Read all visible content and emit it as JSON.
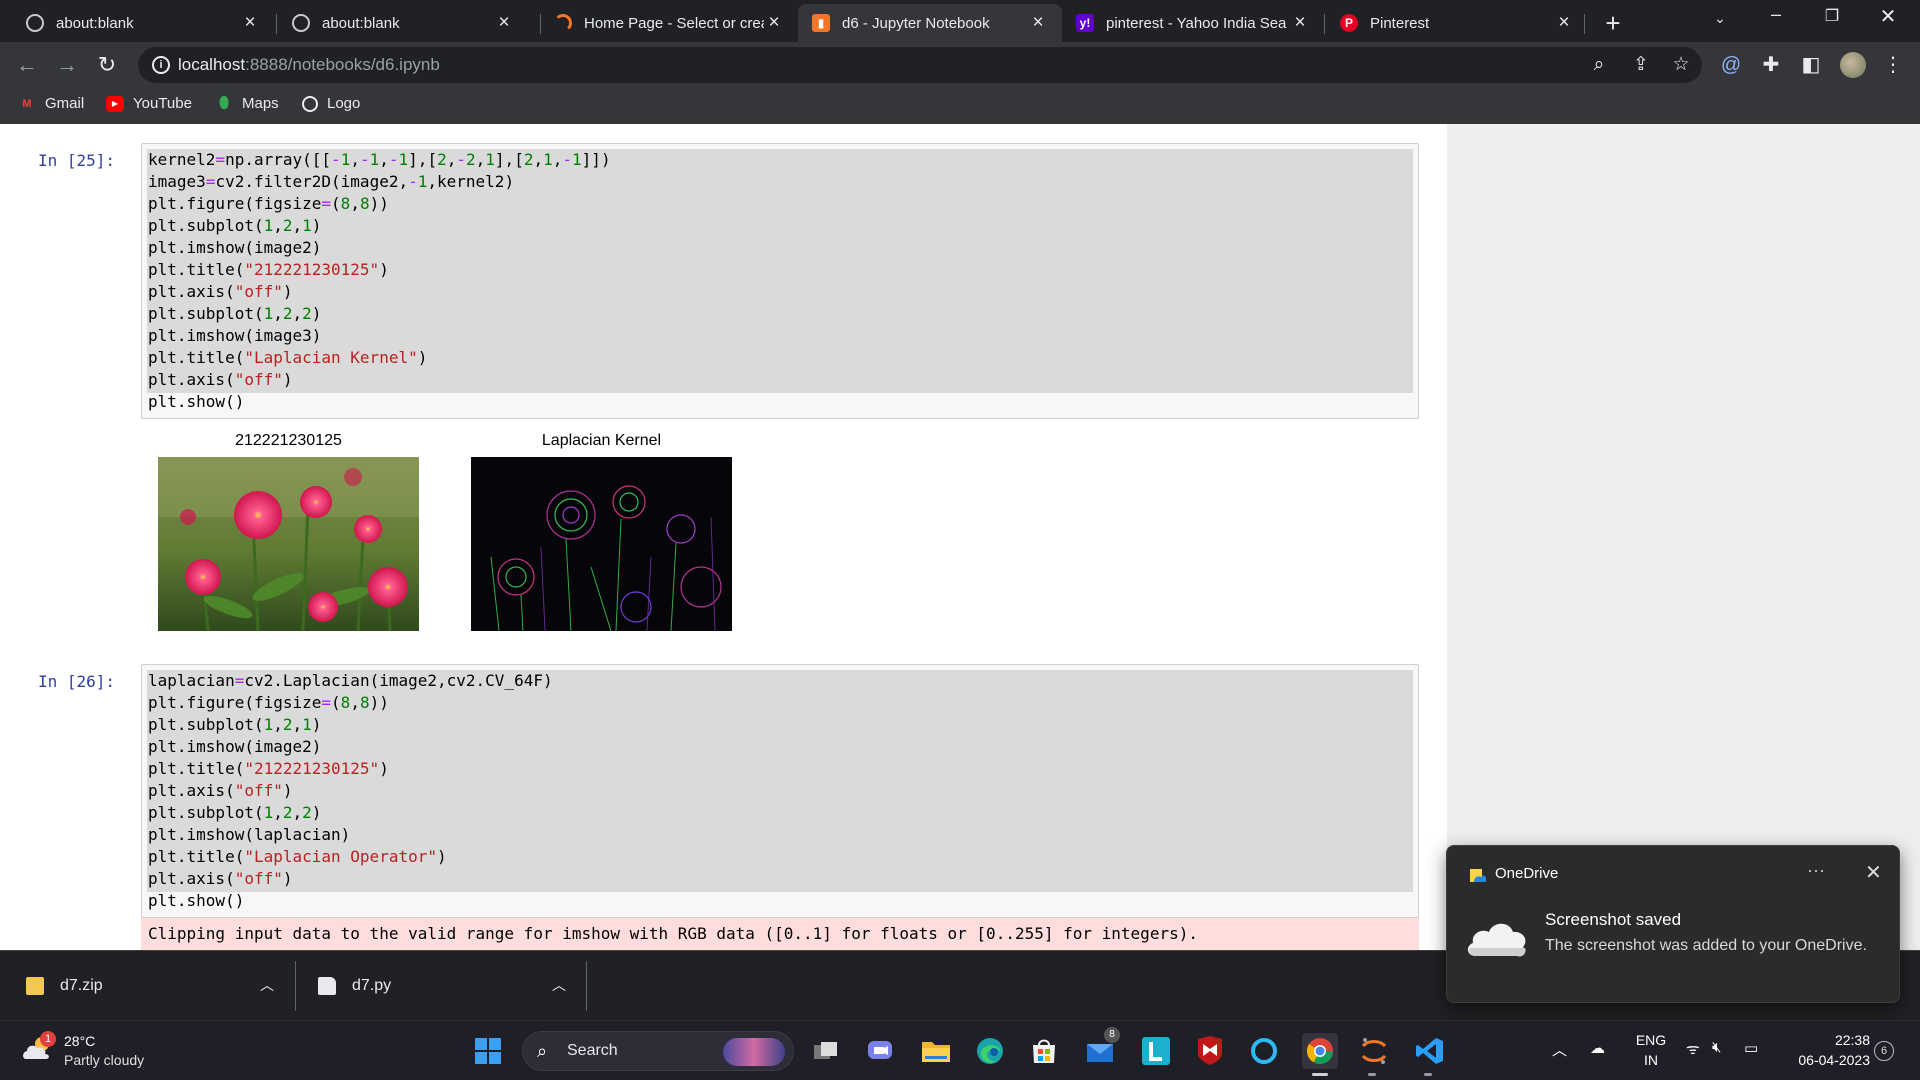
{
  "browser": {
    "tabs": [
      {
        "title": "about:blank",
        "icon": "globe-icon"
      },
      {
        "title": "about:blank",
        "icon": "globe-icon"
      },
      {
        "title": "Home Page - Select or crea",
        "icon": "loading-icon"
      },
      {
        "title": "d6 - Jupyter Notebook",
        "icon": "jupyter-icon"
      },
      {
        "title": "pinterest - Yahoo India Sea",
        "icon": "yahoo-icon"
      },
      {
        "title": "Pinterest",
        "icon": "pinterest-icon"
      }
    ],
    "active_tab": 3,
    "url": {
      "host": "localhost",
      "path": ":8888/notebooks/d6.ipynb"
    },
    "bookmarks": [
      {
        "label": "Gmail",
        "icon": "gmail-icon"
      },
      {
        "label": "YouTube",
        "icon": "youtube-icon"
      },
      {
        "label": "Maps",
        "icon": "maps-icon"
      },
      {
        "label": "Logo",
        "icon": "globe-icon"
      }
    ]
  },
  "notebook": {
    "cell25": {
      "prompt": "In [25]:",
      "code": [
        "kernel2=np.array([[-1,-1,-1],[2,-2,1],[2,1,-1]])",
        "image3=cv2.filter2D(image2,-1,kernel2)",
        "plt.figure(figsize=(8,8))",
        "plt.subplot(1,2,1)",
        "plt.imshow(image2)",
        "plt.title(\"212221230125\")",
        "plt.axis(\"off\")",
        "plt.subplot(1,2,2)",
        "plt.imshow(image3)",
        "plt.title(\"Laplacian Kernel\")",
        "plt.axis(\"off\")",
        "plt.show()"
      ],
      "output_titles": [
        "212221230125",
        "Laplacian Kernel"
      ]
    },
    "cell26": {
      "prompt": "In [26]:",
      "code": [
        "laplacian=cv2.Laplacian(image2,cv2.CV_64F)",
        "plt.figure(figsize=(8,8))",
        "plt.subplot(1,2,1)",
        "plt.imshow(image2)",
        "plt.title(\"212221230125\")",
        "plt.axis(\"off\")",
        "plt.subplot(1,2,2)",
        "plt.imshow(laplacian)",
        "plt.title(\"Laplacian Operator\")",
        "plt.axis(\"off\")",
        "plt.show()"
      ],
      "stderr": "Clipping input data to the valid range for imshow with RGB data ([0..1] for floats or [0..255] for integers)."
    }
  },
  "downloads": [
    {
      "name": "d7.zip",
      "icon": "zip-file-icon"
    },
    {
      "name": "d7.py",
      "icon": "python-file-icon"
    }
  ],
  "toast": {
    "app": "OneDrive",
    "heading": "Screenshot saved",
    "body": "The screenshot was added to your OneDrive."
  },
  "taskbar": {
    "weather_temp": "28°C",
    "weather_desc": "Partly cloudy",
    "weather_badge": "1",
    "search_label": "Search",
    "mail_badge": "8",
    "lang_line1": "ENG",
    "lang_line2": "IN",
    "time": "22:38",
    "date": "06-04-2023",
    "notification_count": "6"
  },
  "colors": {
    "accent_jupyter": "#f37626",
    "prompt_blue": "#303f9f",
    "string_red": "#ba2121",
    "number_green": "#008000",
    "stderr_bg": "#ffdddd"
  }
}
